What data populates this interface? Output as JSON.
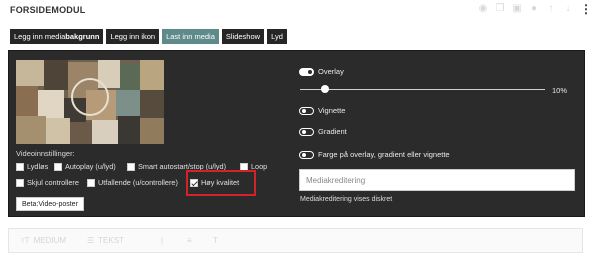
{
  "header": {
    "title": "FORSIDEMODUL",
    "icons": [
      "eye-icon",
      "copy-icon",
      "duplicate-icon",
      "disable-icon",
      "arrow-up-icon",
      "arrow-down-icon",
      "kebab-menu-icon"
    ]
  },
  "toolbar": {
    "buttons": [
      {
        "label_prefix": "Legg inn media",
        "label_bold": "bakgrunn",
        "active": false
      },
      {
        "label": "Legg inn ikon",
        "active": false
      },
      {
        "label": "Last inn media",
        "active": true
      },
      {
        "label": "Slideshow",
        "active": false
      },
      {
        "label": "Lyd",
        "active": false
      }
    ]
  },
  "video": {
    "settings_label": "Videoinnstillinger:",
    "options": [
      {
        "label": "Lydløs",
        "checked": false
      },
      {
        "label": "Autoplay (u/lyd)",
        "checked": false
      },
      {
        "label": "Smart autostart/stop (u/lyd)",
        "checked": false
      },
      {
        "label": "Loop",
        "checked": false
      },
      {
        "label": "Skjul controllere",
        "checked": false
      },
      {
        "label": "Utfallende (u/controllere)",
        "checked": false
      },
      {
        "label": "Høy kvalitet",
        "checked": true
      }
    ],
    "poster_button": "Beta:Video-poster"
  },
  "overlay": {
    "overlay_label": "Overlay",
    "overlay_on": true,
    "slider_value": "10%",
    "slider_fraction": 0.1,
    "vignette_label": "Vignette",
    "gradient_label": "Gradient",
    "color_label": "Farge på overlay, gradient eller vignette"
  },
  "credit": {
    "placeholder": "Mediakreditering",
    "value": "",
    "helper": "Mediakreditering vises diskret"
  },
  "bottom_toolbar": {
    "items": [
      "MEDIUM",
      "TEKST"
    ]
  },
  "colors": {
    "dark_panel": "#2b2b2b",
    "active_button": "#5f8a8b",
    "highlight": "#d2232a"
  }
}
